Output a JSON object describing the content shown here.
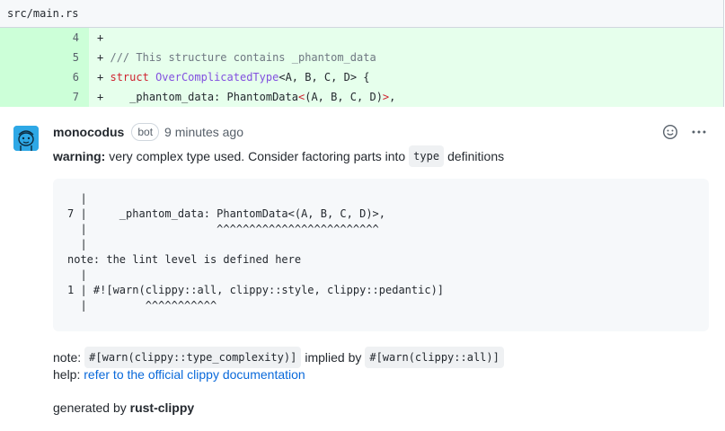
{
  "file": {
    "path": "src/main.rs"
  },
  "diff": {
    "lines": [
      {
        "num": "4",
        "prefix": "+",
        "text": ""
      },
      {
        "num": "5",
        "prefix": "+",
        "text": "/// This structure contains _phantom_data"
      },
      {
        "num": "6",
        "prefix": "+",
        "kw": "struct",
        "ty": "OverComplicatedType",
        "rest": "<A, B, C, D> {"
      },
      {
        "num": "7",
        "prefix": "+",
        "indent": "    ",
        "field": "_phantom_data: PhantomData",
        "gen_open": "<",
        "args": "(A, B, C, D)",
        "gen_close": ">",
        "tail": ","
      }
    ]
  },
  "comment": {
    "author": "monocodus",
    "badge": "bot",
    "time": "9 minutes ago",
    "warning_label": "warning:",
    "warning_text": "very complex type used. Consider factoring parts into",
    "warning_code": "type",
    "warning_tail": "definitions",
    "code_lines": [
      "  |",
      "7 |     _phantom_data: PhantomData<(A, B, C, D)>,",
      "  |                    ^^^^^^^^^^^^^^^^^^^^^^^^^",
      "  |",
      "note: the lint level is defined here",
      "  |",
      "1 | #![warn(clippy::all, clippy::style, clippy::pedantic)]",
      "  |         ^^^^^^^^^^^"
    ],
    "note_label": "note:",
    "note_code1": "#[warn(clippy::type_complexity)]",
    "note_mid": "implied by",
    "note_code2": "#[warn(clippy::all)]",
    "help_label": "help:",
    "help_link": "refer to the official clippy documentation",
    "generated_prefix": "generated by",
    "generated_tool": "rust-clippy"
  },
  "icons": {
    "avatar": "robot-avatar-icon",
    "reaction": "smiley-icon",
    "menu": "kebab-menu-icon"
  },
  "colors": {
    "diff_num_bg": "#ccffd8",
    "diff_code_bg": "#e6ffec",
    "link": "#0969da",
    "avatar_bg": "#2ea8e6"
  }
}
